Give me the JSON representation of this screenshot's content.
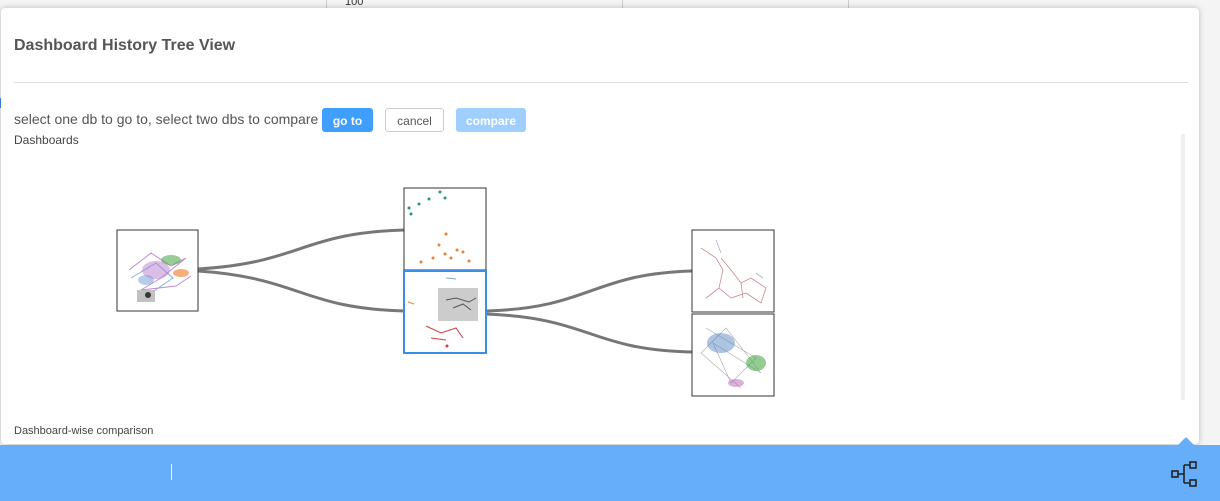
{
  "background": {
    "cell_value": "100"
  },
  "modal": {
    "title": "Dashboard History Tree View",
    "instructions": "select one db to go to, select two dbs to compare",
    "buttons": {
      "go_to": "go to",
      "cancel": "cancel",
      "compare": "compare"
    },
    "sections": {
      "dashboards": "Dashboards",
      "comparison": "Dashboard-wise comparison"
    },
    "tree": {
      "nodes": [
        {
          "id": "root",
          "selected": false
        },
        {
          "id": "child-a",
          "selected": false
        },
        {
          "id": "child-b",
          "selected": true
        },
        {
          "id": "grandchild-a",
          "selected": false
        },
        {
          "id": "grandchild-b",
          "selected": false
        }
      ],
      "edges": [
        {
          "from": "root",
          "to": "child-a"
        },
        {
          "from": "root",
          "to": "child-b"
        },
        {
          "from": "child-b",
          "to": "grandchild-a"
        },
        {
          "from": "child-b",
          "to": "grandchild-b"
        }
      ]
    }
  },
  "bottom_bar": {
    "icon": "tree-structure-icon"
  },
  "colors": {
    "accent": "#409eff",
    "accent_light": "#a0cfff",
    "bottom_bar": "#66adfa",
    "edge": "#777777",
    "selected_border": "#3a8ee6"
  }
}
